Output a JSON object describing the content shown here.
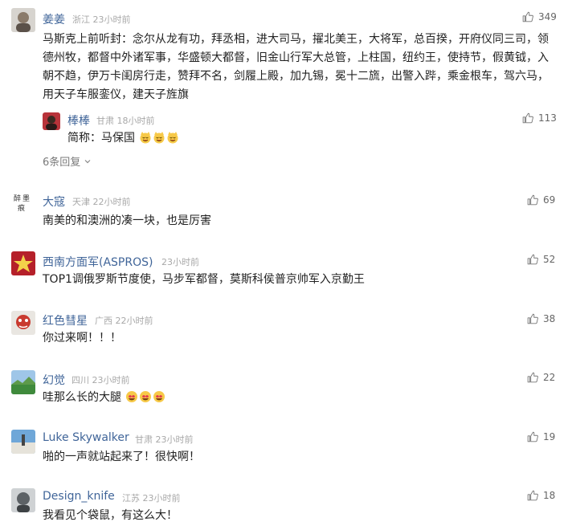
{
  "comments": [
    {
      "name": "姜姜",
      "region": "浙江",
      "time": "23小时前",
      "likes": "349",
      "text": "马斯克上前听封：念尔从龙有功，拜丞相，进大司马，擢北美王，大将军，总百揆，开府仪同三司，领德州牧，都督中外诸军事，华盛顿大都督，旧金山行军大总管，上柱国，纽约王，使持节，假黄钺，入朝不趋，伊万卡闺房行走，赞拜不名，剑履上殿，加九锡，冕十二旒，出警入跸，乘金根车，驾六马，用天子车服銮仪，建天子旌旗",
      "reply": {
        "name": "棒棒",
        "region": "甘肃",
        "time": "18小时前",
        "likes": "113",
        "text": "简称：马保国"
      },
      "more_replies": "6条回复"
    },
    {
      "name": "大寇",
      "region": "天津",
      "time": "22小时前",
      "likes": "69",
      "text": "南美的和澳洲的凑一块，也是厉害"
    },
    {
      "name": "西南方面军(ASPROS)",
      "region": "",
      "time": "23小时前",
      "likes": "52",
      "text": "TOP1调俄罗斯节度使，马步军都督，莫斯科侯普京帅军入京勤王"
    },
    {
      "name": "红色彗星",
      "region": "广西",
      "time": "22小时前",
      "likes": "38",
      "text": "你过来啊！！！"
    },
    {
      "name": "幻觉",
      "region": "四川",
      "time": "23小时前",
      "likes": "22",
      "text": "哇那么长的大腿"
    },
    {
      "name": "Luke Skywalker",
      "region": "甘肃",
      "time": "23小时前",
      "likes": "19",
      "text": "啪的一声就站起来了！很快啊！"
    },
    {
      "name": "Design_knife",
      "region": "江苏",
      "time": "23小时前",
      "likes": "18",
      "text": "我看见个袋鼠，有这么大！"
    }
  ],
  "colors": {
    "name": "#406599",
    "meta": "#a8a8a8",
    "text": "#222222",
    "divider": "#eeeeee"
  },
  "icons": {
    "like": "thumbs-up-icon",
    "more": "chevron-down-icon",
    "emoji_cat": "cat-laugh-emoji",
    "emoji_heart_eyes": "heart-eyes-emoji"
  }
}
